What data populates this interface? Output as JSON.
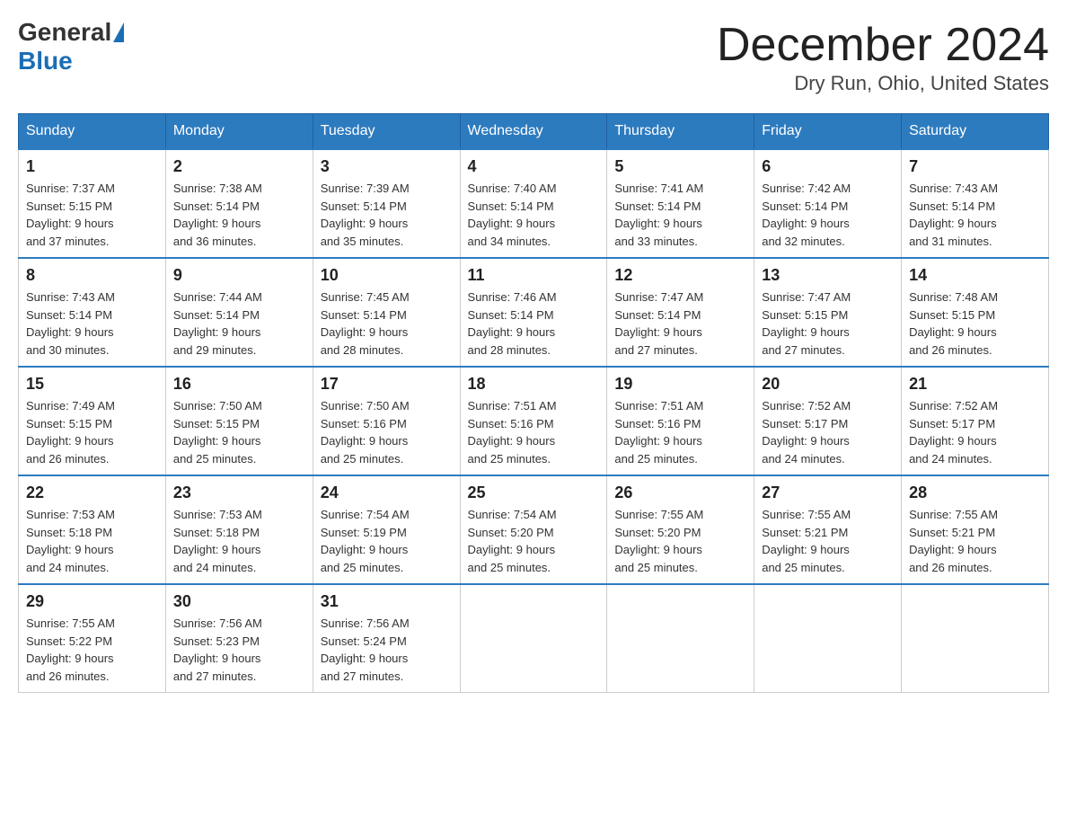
{
  "header": {
    "logo_general": "General",
    "logo_blue": "Blue",
    "month_title": "December 2024",
    "location": "Dry Run, Ohio, United States"
  },
  "days_of_week": [
    "Sunday",
    "Monday",
    "Tuesday",
    "Wednesday",
    "Thursday",
    "Friday",
    "Saturday"
  ],
  "weeks": [
    [
      {
        "day": "1",
        "sunrise": "7:37 AM",
        "sunset": "5:15 PM",
        "daylight": "9 hours and 37 minutes."
      },
      {
        "day": "2",
        "sunrise": "7:38 AM",
        "sunset": "5:14 PM",
        "daylight": "9 hours and 36 minutes."
      },
      {
        "day": "3",
        "sunrise": "7:39 AM",
        "sunset": "5:14 PM",
        "daylight": "9 hours and 35 minutes."
      },
      {
        "day": "4",
        "sunrise": "7:40 AM",
        "sunset": "5:14 PM",
        "daylight": "9 hours and 34 minutes."
      },
      {
        "day": "5",
        "sunrise": "7:41 AM",
        "sunset": "5:14 PM",
        "daylight": "9 hours and 33 minutes."
      },
      {
        "day": "6",
        "sunrise": "7:42 AM",
        "sunset": "5:14 PM",
        "daylight": "9 hours and 32 minutes."
      },
      {
        "day": "7",
        "sunrise": "7:43 AM",
        "sunset": "5:14 PM",
        "daylight": "9 hours and 31 minutes."
      }
    ],
    [
      {
        "day": "8",
        "sunrise": "7:43 AM",
        "sunset": "5:14 PM",
        "daylight": "9 hours and 30 minutes."
      },
      {
        "day": "9",
        "sunrise": "7:44 AM",
        "sunset": "5:14 PM",
        "daylight": "9 hours and 29 minutes."
      },
      {
        "day": "10",
        "sunrise": "7:45 AM",
        "sunset": "5:14 PM",
        "daylight": "9 hours and 28 minutes."
      },
      {
        "day": "11",
        "sunrise": "7:46 AM",
        "sunset": "5:14 PM",
        "daylight": "9 hours and 28 minutes."
      },
      {
        "day": "12",
        "sunrise": "7:47 AM",
        "sunset": "5:14 PM",
        "daylight": "9 hours and 27 minutes."
      },
      {
        "day": "13",
        "sunrise": "7:47 AM",
        "sunset": "5:15 PM",
        "daylight": "9 hours and 27 minutes."
      },
      {
        "day": "14",
        "sunrise": "7:48 AM",
        "sunset": "5:15 PM",
        "daylight": "9 hours and 26 minutes."
      }
    ],
    [
      {
        "day": "15",
        "sunrise": "7:49 AM",
        "sunset": "5:15 PM",
        "daylight": "9 hours and 26 minutes."
      },
      {
        "day": "16",
        "sunrise": "7:50 AM",
        "sunset": "5:15 PM",
        "daylight": "9 hours and 25 minutes."
      },
      {
        "day": "17",
        "sunrise": "7:50 AM",
        "sunset": "5:16 PM",
        "daylight": "9 hours and 25 minutes."
      },
      {
        "day": "18",
        "sunrise": "7:51 AM",
        "sunset": "5:16 PM",
        "daylight": "9 hours and 25 minutes."
      },
      {
        "day": "19",
        "sunrise": "7:51 AM",
        "sunset": "5:16 PM",
        "daylight": "9 hours and 25 minutes."
      },
      {
        "day": "20",
        "sunrise": "7:52 AM",
        "sunset": "5:17 PM",
        "daylight": "9 hours and 24 minutes."
      },
      {
        "day": "21",
        "sunrise": "7:52 AM",
        "sunset": "5:17 PM",
        "daylight": "9 hours and 24 minutes."
      }
    ],
    [
      {
        "day": "22",
        "sunrise": "7:53 AM",
        "sunset": "5:18 PM",
        "daylight": "9 hours and 24 minutes."
      },
      {
        "day": "23",
        "sunrise": "7:53 AM",
        "sunset": "5:18 PM",
        "daylight": "9 hours and 24 minutes."
      },
      {
        "day": "24",
        "sunrise": "7:54 AM",
        "sunset": "5:19 PM",
        "daylight": "9 hours and 25 minutes."
      },
      {
        "day": "25",
        "sunrise": "7:54 AM",
        "sunset": "5:20 PM",
        "daylight": "9 hours and 25 minutes."
      },
      {
        "day": "26",
        "sunrise": "7:55 AM",
        "sunset": "5:20 PM",
        "daylight": "9 hours and 25 minutes."
      },
      {
        "day": "27",
        "sunrise": "7:55 AM",
        "sunset": "5:21 PM",
        "daylight": "9 hours and 25 minutes."
      },
      {
        "day": "28",
        "sunrise": "7:55 AM",
        "sunset": "5:21 PM",
        "daylight": "9 hours and 26 minutes."
      }
    ],
    [
      {
        "day": "29",
        "sunrise": "7:55 AM",
        "sunset": "5:22 PM",
        "daylight": "9 hours and 26 minutes."
      },
      {
        "day": "30",
        "sunrise": "7:56 AM",
        "sunset": "5:23 PM",
        "daylight": "9 hours and 27 minutes."
      },
      {
        "day": "31",
        "sunrise": "7:56 AM",
        "sunset": "5:24 PM",
        "daylight": "9 hours and 27 minutes."
      },
      null,
      null,
      null,
      null
    ]
  ],
  "labels": {
    "sunrise_prefix": "Sunrise: ",
    "sunset_prefix": "Sunset: ",
    "daylight_prefix": "Daylight: "
  }
}
